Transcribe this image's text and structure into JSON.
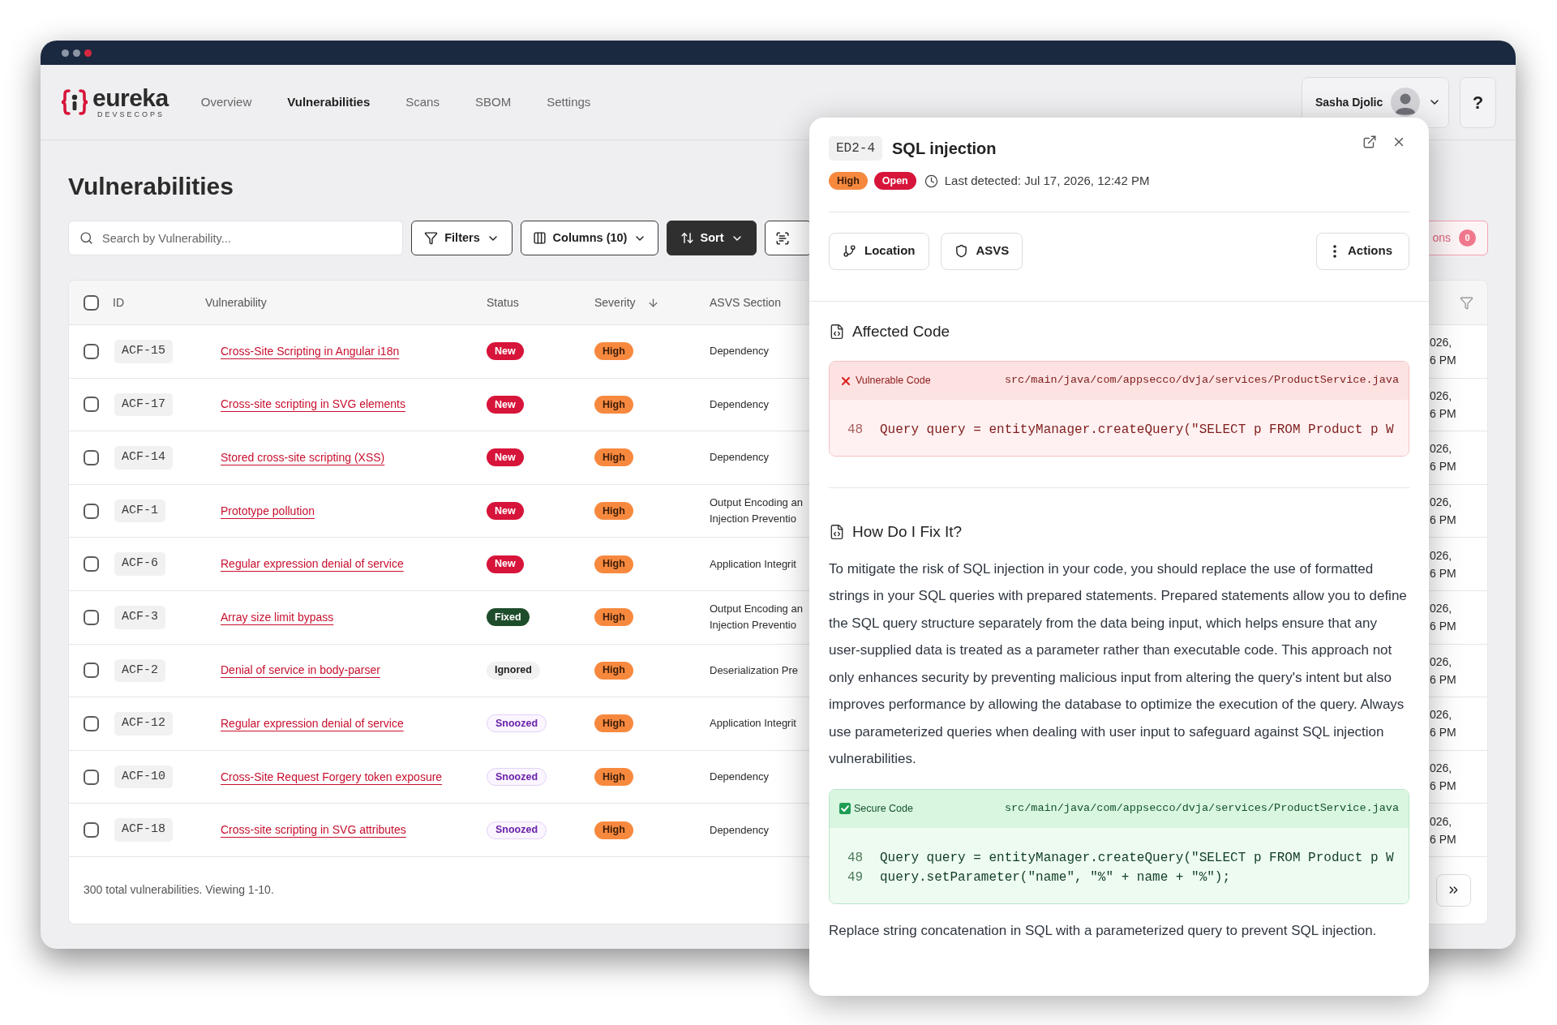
{
  "window": {
    "controls": [
      {
        "color": "#8b95a5"
      },
      {
        "color": "#8b95a5"
      },
      {
        "color": "#d7283f"
      }
    ]
  },
  "header": {
    "brand": {
      "name": "eureka",
      "tagline": "DEVSECOPS"
    },
    "nav": [
      {
        "label": "Overview",
        "selected": false
      },
      {
        "label": "Vulnerabilities",
        "selected": true
      },
      {
        "label": "Scans",
        "selected": false
      },
      {
        "label": "SBOM",
        "selected": false
      },
      {
        "label": "Settings",
        "selected": false
      }
    ],
    "user": {
      "name": "Sasha Djolic"
    },
    "help": "?"
  },
  "page": {
    "title": "Vulnerabilities"
  },
  "toolbar": {
    "search": {
      "placeholder": "Search by Vulnerability..."
    },
    "buttons": [
      {
        "label": "Filters",
        "kind": "filters"
      },
      {
        "label": "Columns (10)",
        "kind": "columns"
      },
      {
        "label": "Sort",
        "kind": "sort"
      },
      {
        "kind": "scan"
      }
    ],
    "selection": {
      "label": "ons",
      "count": "0"
    }
  },
  "table": {
    "select_all": {
      "checked": false
    },
    "columns": [
      {
        "label": "ID"
      },
      {
        "label": "Vulnerability"
      },
      {
        "label": "Status"
      },
      {
        "label": "Severity",
        "sorted": true
      },
      {
        "label": "ASVS Section"
      }
    ],
    "rows": [
      {
        "checked": false,
        "id": "ACF-15",
        "vulnerability": "Cross-Site Scripting in Angular i18n",
        "status": {
          "label": "New",
          "kind": "new"
        },
        "severity": {
          "label": "High",
          "kind": "high"
        },
        "asvs_section": [
          "Dependency"
        ],
        "column_7": [
          "026,",
          "6 PM"
        ]
      },
      {
        "checked": false,
        "id": "ACF-17",
        "vulnerability": "Cross-site scripting in SVG elements",
        "status": {
          "label": "New",
          "kind": "new"
        },
        "severity": {
          "label": "High",
          "kind": "high"
        },
        "asvs_section": [
          "Dependency"
        ],
        "column_7": [
          "026,",
          "6 PM"
        ]
      },
      {
        "checked": false,
        "id": "ACF-14",
        "vulnerability": "Stored cross-site scripting (XSS)",
        "status": {
          "label": "New",
          "kind": "new"
        },
        "severity": {
          "label": "High",
          "kind": "high"
        },
        "asvs_section": [
          "Dependency"
        ],
        "column_7": [
          "026,",
          "6 PM"
        ]
      },
      {
        "checked": false,
        "id": "ACF-1",
        "vulnerability": "Prototype pollution",
        "status": {
          "label": "New",
          "kind": "new"
        },
        "severity": {
          "label": "High",
          "kind": "high"
        },
        "asvs_section": [
          "Output Encoding an",
          "Injection Preventio"
        ],
        "column_7": [
          "026,",
          "6 PM"
        ]
      },
      {
        "checked": false,
        "id": "ACF-6",
        "vulnerability": "Regular expression denial of service",
        "status": {
          "label": "New",
          "kind": "new"
        },
        "severity": {
          "label": "High",
          "kind": "high"
        },
        "asvs_section": [
          "Application Integrit"
        ],
        "column_7": [
          "026,",
          "6 PM"
        ]
      },
      {
        "checked": false,
        "id": "ACF-3",
        "vulnerability": "Array size limit bypass",
        "status": {
          "label": "Fixed",
          "kind": "fixed"
        },
        "severity": {
          "label": "High",
          "kind": "high"
        },
        "asvs_section": [
          "Output Encoding an",
          "Injection Preventio"
        ],
        "column_7": [
          "026,",
          "6 PM"
        ]
      },
      {
        "checked": false,
        "id": "ACF-2",
        "vulnerability": "Denial of service in body-parser",
        "status": {
          "label": "Ignored",
          "kind": "ignored"
        },
        "severity": {
          "label": "High",
          "kind": "high"
        },
        "asvs_section": [
          "Deserialization Pre"
        ],
        "column_7": [
          "026,",
          "6 PM"
        ]
      },
      {
        "checked": false,
        "id": "ACF-12",
        "vulnerability": "Regular expression denial of service",
        "status": {
          "label": "Snoozed",
          "kind": "snoozed"
        },
        "severity": {
          "label": "High",
          "kind": "high"
        },
        "asvs_section": [
          "Application Integrit"
        ],
        "column_7": [
          "026,",
          "6 PM"
        ]
      },
      {
        "checked": false,
        "id": "ACF-10",
        "vulnerability": "Cross-Site Request Forgery token exposure",
        "status": {
          "label": "Snoozed",
          "kind": "snoozed"
        },
        "severity": {
          "label": "High",
          "kind": "high"
        },
        "asvs_section": [
          "Dependency"
        ],
        "column_7": [
          "026,",
          "6 PM"
        ]
      },
      {
        "checked": false,
        "id": "ACF-18",
        "vulnerability": "Cross-site scripting in SVG attributes",
        "status": {
          "label": "Snoozed",
          "kind": "snoozed"
        },
        "severity": {
          "label": "High",
          "kind": "high"
        },
        "asvs_section": [
          "Dependency"
        ],
        "column_7": [
          "026,",
          "6 PM"
        ]
      }
    ],
    "footer": {
      "summary": "300 total vulnerabilities. Viewing 1-10."
    }
  },
  "detail_panel": {
    "id": "ED2-4",
    "title": "SQL injection",
    "severity": {
      "label": "High",
      "kind": "high"
    },
    "status": {
      "label": "Open",
      "kind": "open"
    },
    "last_detected": "Last detected: Jul 17, 2026, 12:42 PM",
    "buttons": [
      {
        "label": "Location",
        "kind": "location"
      },
      {
        "label": "ASVS",
        "kind": "asvs"
      }
    ],
    "actions": "Actions",
    "affected_code": {
      "heading": "Affected Code",
      "snippet": {
        "kind": "vulnerable",
        "label": "Vulnerable Code",
        "path": "src/main/java/com/appsecco/dvja/services/ProductService.java",
        "lines": [
          {
            "number": "48",
            "code": "Query query = entityManager.createQuery(\"SELECT p FROM Product p W"
          }
        ]
      }
    },
    "fix": {
      "heading": "How Do I Fix It?",
      "text": "To mitigate the risk of SQL injection in your code, you should replace the use of formatted strings in your SQL queries with prepared statements. Prepared statements allow you to define the SQL query structure separately from the data being input, which helps ensure that any user-supplied data is treated as a parameter rather than executable code. This approach not only enhances security by preventing malicious input from altering the query's intent but also improves performance by allowing the database to optimize the execution of the query. Always use parameterized queries when dealing with user input to safeguard against SQL injection vulnerabilities.",
      "snippet": {
        "kind": "secure",
        "label": "Secure Code",
        "path": "src/main/java/com/appsecco/dvja/services/ProductService.java",
        "lines": [
          {
            "number": "48",
            "code": "Query query = entityManager.createQuery(\"SELECT p FROM Product p W"
          },
          {
            "number": "49",
            "code": "query.setParameter(\"name\", \"%\" + name + \"%\");"
          }
        ]
      },
      "note": "Replace string concatenation in SQL with a parameterized query to prevent SQL injection."
    }
  }
}
